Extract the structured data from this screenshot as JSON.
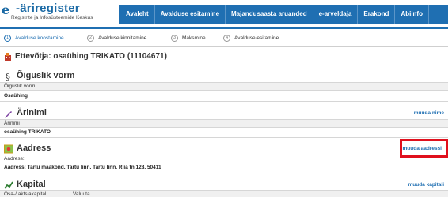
{
  "logo": {
    "mark": "e",
    "title": "-äriregister",
    "subtitle": "Registrite ja Infosüsteemide Keskus"
  },
  "nav": [
    {
      "label": "Avaleht"
    },
    {
      "label": "Avalduse esitamine"
    },
    {
      "label": "Majandusaasta aruanded"
    },
    {
      "label": "e-arveldaja"
    },
    {
      "label": "Erakond"
    },
    {
      "label": "Abiinfo"
    }
  ],
  "steps": [
    {
      "num": "1",
      "label": "Avalduse koostamine"
    },
    {
      "num": "2",
      "label": "Avalduse kinnitamine"
    },
    {
      "num": "3",
      "label": "Maksmine"
    },
    {
      "num": "4",
      "label": "Avalduse esitamine"
    }
  ],
  "company": {
    "title": "Ettevõtja: osaühing TRIKATO (11104671)"
  },
  "sections": {
    "legal_form": {
      "title": "Õiguslik vorm",
      "label": "Õiguslik vorm",
      "value": "Osaühing"
    },
    "business_name": {
      "title": "Ärinimi",
      "link": "muuda nime",
      "label": "Ärinimi",
      "value": "osaühing TRIKATO"
    },
    "address": {
      "title": "Aadress",
      "link": "muuda aadressi",
      "label": "Aadress:",
      "value": "Aadress: Tartu maakond, Tartu linn, Tartu linn, Riia tn 128, 50411"
    },
    "capital": {
      "title": "Kapital",
      "link": "muuda kapitali",
      "label1": "Osa-/ aktsiakapital",
      "label2": "Valuuta"
    }
  },
  "colors": {
    "brand": "#1f6fb2",
    "highlight": "#e0101d"
  }
}
